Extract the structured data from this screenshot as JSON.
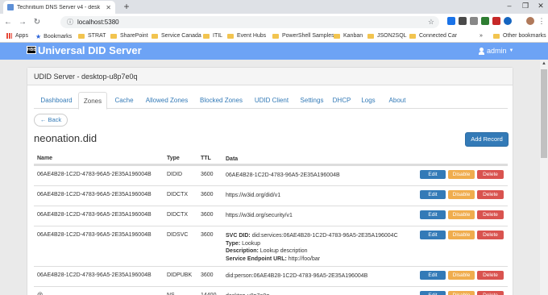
{
  "browser": {
    "tab_title": "Technitium DNS Server v4 - desk",
    "url": "localhost:5380",
    "bookmarks": [
      "Apps",
      "Bookmarks",
      "STRAT",
      "SharePoint",
      "Service Canada",
      "ITIL",
      "Event Hubs",
      "PowerShell Samples",
      "Kanban",
      "JSON2SQL",
      "Connected Car",
      "Other bookmarks"
    ],
    "more_label": "»"
  },
  "app": {
    "logo_text": "HBB",
    "title": "Universal DID Server",
    "user": "admin"
  },
  "panel": {
    "heading": "UDID Server - desktop-u8p7e0q",
    "tabs": [
      "Dashboard",
      "Zones",
      "Cache",
      "Allowed Zones",
      "Blocked Zones",
      "UDID Client",
      "Settings",
      "DHCP",
      "Logs",
      "About"
    ],
    "active_tab": "Zones",
    "back_label": "← Back",
    "zone_name": "neonation.did",
    "add_record_label": "Add Record"
  },
  "table": {
    "headers": {
      "name": "Name",
      "type": "Type",
      "ttl": "TTL",
      "data": "Data"
    },
    "action_labels": {
      "edit": "Edit",
      "disable": "Disable",
      "delete": "Delete"
    },
    "rows": [
      {
        "name": "06AE4B28-1C2D-4783-96A5-2E35A196004B",
        "type": "DIDID",
        "ttl": "3600",
        "data": "06AE4B28-1C2D-4783-96A5-2E35A196004B"
      },
      {
        "name": "06AE4B28-1C2D-4783-96A5-2E35A196004B",
        "type": "DIDCTX",
        "ttl": "3600",
        "data": "https://w3id.org/did/v1"
      },
      {
        "name": "06AE4B28-1C2D-4783-96A5-2E35A196004B",
        "type": "DIDCTX",
        "ttl": "3600",
        "data": "https://w3id.org/security/v1"
      },
      {
        "name": "06AE4B28-1C2D-4783-96A5-2E35A196004B",
        "type": "DIDSVC",
        "ttl": "3600",
        "svc": {
          "did_label": "SVC DID:",
          "did_value": "did:services:06AE4B28-1C2D-4783-96A5-2E35A196004C",
          "type_label": "Type:",
          "type_value": "Lookup",
          "desc_label": "Description:",
          "desc_value": "Lookup description",
          "url_label": "Service Endpoint URL:",
          "url_value": "http://foo/bar"
        }
      },
      {
        "name": "06AE4B28-1C2D-4783-96A5-2E35A196004B",
        "type": "DIDPUBK",
        "ttl": "3600",
        "data": "did:person:06AE4B28-1C2D-4783-96A5-2E35A196004B"
      },
      {
        "name": "@",
        "type": "NS",
        "ttl": "14400",
        "data": "desktop-u8p7e0q"
      }
    ]
  },
  "colors": {
    "accent": "#6da3f5",
    "primary": "#337ab7",
    "warning": "#f0ad4e",
    "danger": "#d9534f"
  }
}
